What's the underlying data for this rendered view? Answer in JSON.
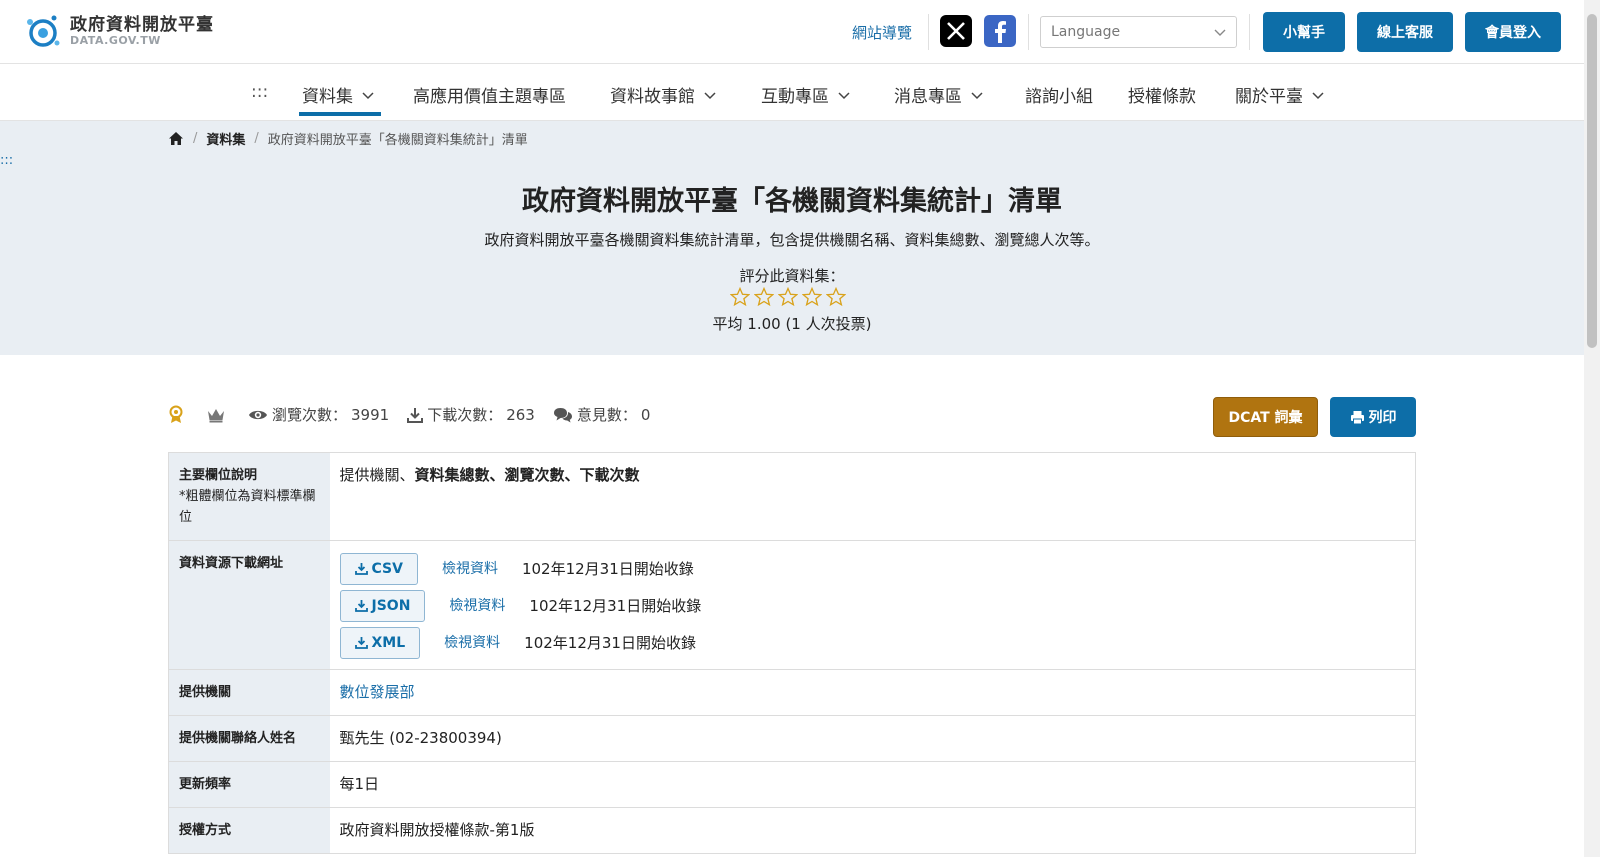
{
  "logo": {
    "title": "政府資料開放平臺",
    "subtitle": "DATA.GOV.TW"
  },
  "header": {
    "site_nav": "網站導覽",
    "language_placeholder": "Language",
    "buttons": {
      "helper": "小幫手",
      "support": "線上客服",
      "login": "會員登入"
    }
  },
  "nav": {
    "accesskey": ":::",
    "items": [
      {
        "label": "資料集",
        "has_dropdown": true,
        "active": true
      },
      {
        "label": "高應用價值主題專區",
        "has_dropdown": false
      },
      {
        "label": "資料故事館",
        "has_dropdown": true
      },
      {
        "label": "互動專區",
        "has_dropdown": true
      },
      {
        "label": "消息專區",
        "has_dropdown": true
      },
      {
        "label": "諮詢小組",
        "has_dropdown": false
      },
      {
        "label": "授權條款",
        "has_dropdown": false
      },
      {
        "label": "關於平臺",
        "has_dropdown": true
      }
    ]
  },
  "breadcrumb": {
    "level1": "資料集",
    "current": "政府資料開放平臺「各機關資料集統計」清單"
  },
  "hero": {
    "accesskey": ":::",
    "title": "政府資料開放平臺「各機關資料集統計」清單",
    "description": "政府資料開放平臺各機關資料集統計清單，包含提供機關名稱、資料集總數、瀏覽總人次等。",
    "rate_label": "評分此資料集：",
    "stars_filled": 0,
    "stars_total": 5,
    "average": "平均 1.00 (1 人次投票)"
  },
  "stats": {
    "views_label": "瀏覽次數：",
    "views": "3991",
    "downloads_label": "下載次數：",
    "downloads": "263",
    "comments_label": "意見數：",
    "comments": "0"
  },
  "actions": {
    "dcat": "DCAT 詞彙",
    "print": "列印"
  },
  "info": {
    "main_fields_label": "主要欄位說明",
    "main_fields_note": "*粗體欄位為資料標準欄位",
    "main_fields_plain": "提供機關、",
    "main_fields_bold": "資料集總數、瀏覽次數、下載次數",
    "resources_label": "資料資源下載網址",
    "resources": [
      {
        "format": "CSV",
        "view": "檢視資料",
        "since": "102年12月31日開始收錄"
      },
      {
        "format": "JSON",
        "view": "檢視資料",
        "since": "102年12月31日開始收錄"
      },
      {
        "format": "XML",
        "view": "檢視資料",
        "since": "102年12月31日開始收錄"
      }
    ],
    "provider_label": "提供機關",
    "provider": "數位發展部",
    "contact_label": "提供機關聯絡人姓名",
    "contact": "甄先生 (02-23800394)",
    "frequency_label": "更新頻率",
    "frequency": "每1日",
    "license_label": "授權方式",
    "license": "政府資料開放授權條款-第1版"
  },
  "colors": {
    "primary": "#0d6ea8",
    "dcat": "#b07410",
    "hero_bg": "#e9eef3",
    "link": "#1a6ea8",
    "star": "#d9a21a"
  }
}
